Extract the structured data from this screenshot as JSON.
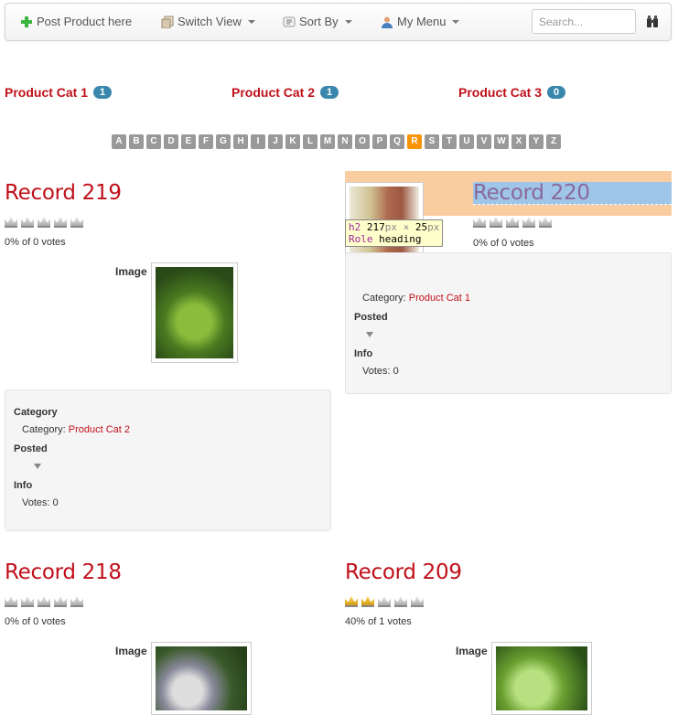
{
  "nav": {
    "post": "Post Product here",
    "switch_view": "Switch View",
    "sort_by": "Sort By",
    "my_menu": "My Menu",
    "search_placeholder": "Search..."
  },
  "categories": [
    {
      "name": "Product Cat 1",
      "count": "1"
    },
    {
      "name": "Product Cat 2",
      "count": "1"
    },
    {
      "name": "Product Cat 3",
      "count": "0"
    }
  ],
  "alphabet": [
    "A",
    "B",
    "C",
    "D",
    "E",
    "F",
    "G",
    "H",
    "I",
    "J",
    "K",
    "L",
    "M",
    "N",
    "O",
    "P",
    "Q",
    "R",
    "S",
    "T",
    "U",
    "V",
    "W",
    "X",
    "Y",
    "Z"
  ],
  "alphabet_active": "R",
  "labels": {
    "image": "Image",
    "category": "Category",
    "category_prefix": "Category: ",
    "posted": "Posted",
    "info": "Info"
  },
  "records": [
    {
      "title": "Record 219",
      "rating": 0,
      "votes": "0% of 0 votes",
      "category": "Product Cat 2",
      "votes_info": "Votes: 0"
    },
    {
      "title": "Record 220",
      "rating": 0,
      "votes": "0% of 0 votes",
      "category": "Product Cat 1",
      "votes_info": "Votes: 0"
    },
    {
      "title": "Record 218",
      "rating": 0,
      "votes": "0% of 0 votes"
    },
    {
      "title": "Record 209",
      "rating": 2,
      "votes": "40% of 1 votes"
    }
  ],
  "tooltip": {
    "tag": "h2",
    "width": "217",
    "height": "25",
    "unit": "px",
    "times": "×",
    "role_label": "Role",
    "role": "heading"
  },
  "colors": {
    "accent": "#c0101a",
    "badge": "#3a87ad",
    "active_letter": "#f89406"
  }
}
